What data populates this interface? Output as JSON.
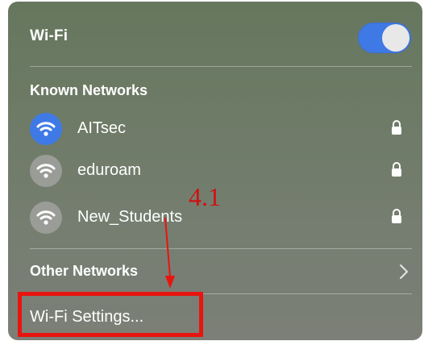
{
  "wifi": {
    "title": "Wi-Fi",
    "enabled": true,
    "toggle_color": "#3f79e6"
  },
  "known_networks": {
    "label": "Known Networks",
    "items": [
      {
        "name": "AITsec",
        "connected": true,
        "locked": true,
        "icon": "wifi-icon",
        "lock_icon": "lock-icon"
      },
      {
        "name": "eduroam",
        "connected": false,
        "locked": true,
        "icon": "wifi-icon",
        "lock_icon": "lock-icon"
      },
      {
        "name": "New_Students",
        "connected": false,
        "locked": true,
        "icon": "wifi-icon",
        "lock_icon": "lock-icon"
      }
    ]
  },
  "other_networks": {
    "label": "Other Networks",
    "icon": "chevron-right-icon"
  },
  "settings": {
    "label": "Wi-Fi Settings..."
  },
  "annotation": {
    "label": "4.1",
    "color": "#e8140f"
  }
}
